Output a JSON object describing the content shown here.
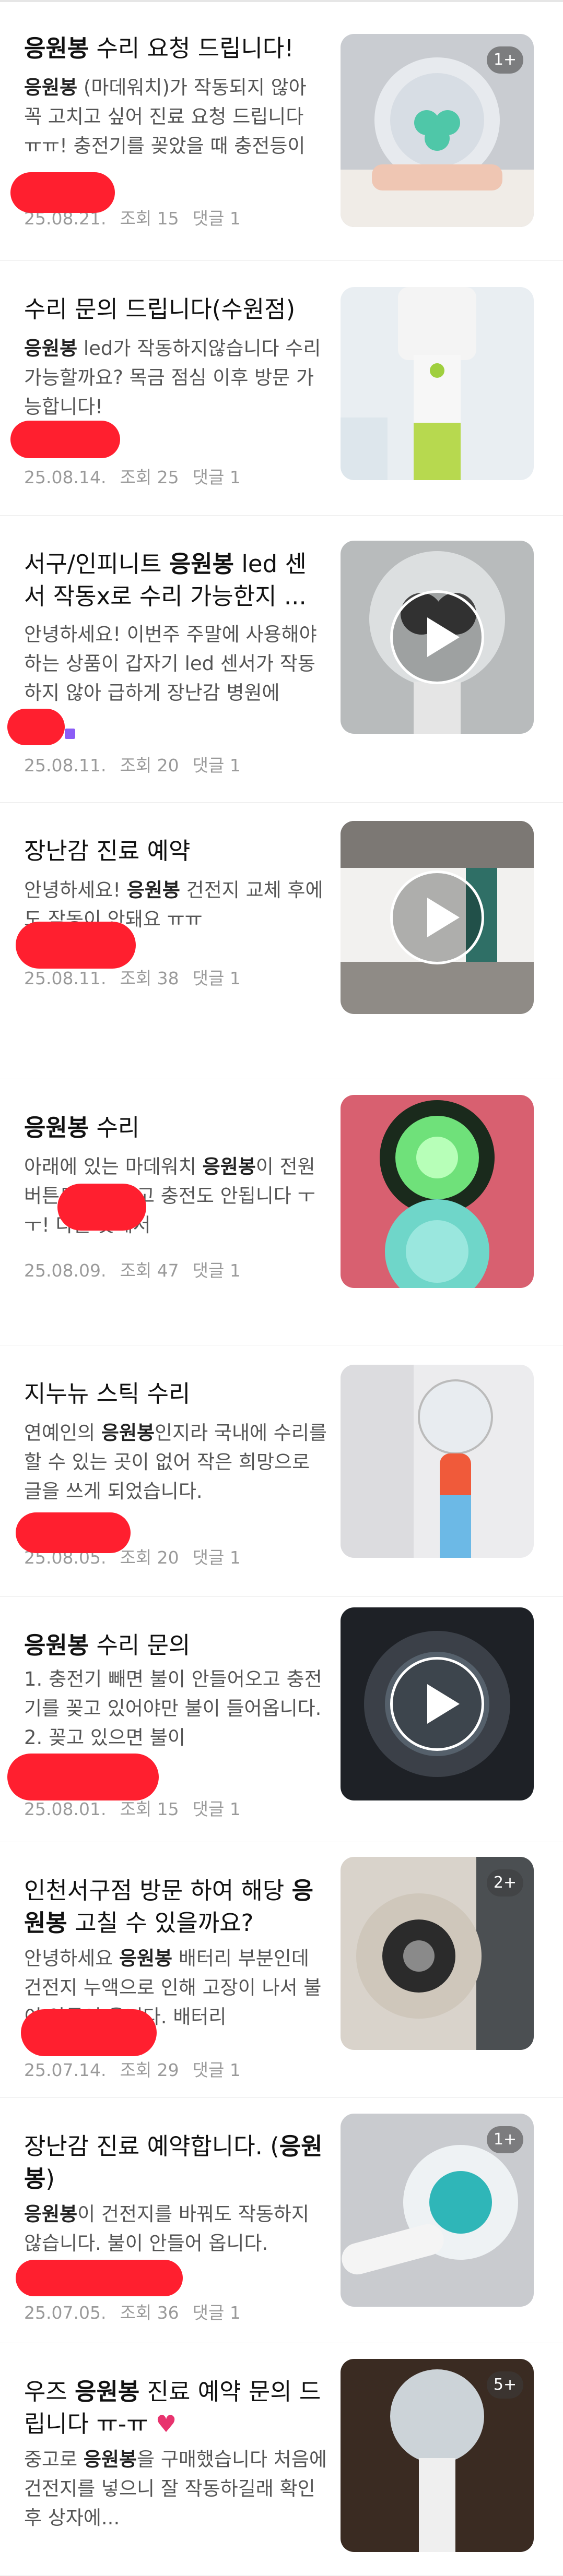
{
  "posts": [
    {
      "title": "<b>응원봉</b> 수리 요청 드립니다!",
      "body": "<b>응원봉</b> (마데워치)가 작동되지 않아 꼭 고치고 싶어 진료 요청 드립니다 ㅠㅠ! 충전기를 꽂았을 때 충전등이",
      "date": "25.08.21.",
      "views": "조회 15",
      "comments": "댓글 1",
      "badge": "1+",
      "play": false
    },
    {
      "title": "수리 문의 드립니다(수원점)",
      "body": "<b>응원봉</b> led가 작동하지않습니다 수리 가능할까요? 목금 점심 이후 방문 가능합니다!",
      "date": "25.08.14.",
      "views": "조회 25",
      "comments": "댓글 1",
      "badge": "",
      "play": false
    },
    {
      "title": "서구/인피니트 <b>응원봉</b> led 센서 작동x로 수리 가능한지 ...",
      "body": "안녕하세요! 이번주 주말에 사용해야 하는 상품이 갑자기 led 센서가 작동하지 않아 급하게 장난감 병원에",
      "date": "25.08.11.",
      "views": "조회 20",
      "comments": "댓글 1",
      "badge": "",
      "play": true
    },
    {
      "title": "장난감 진료 예약",
      "body": "안녕하세요! <b>응원봉</b> 건전지 교체 후에도 작동이 안돼요 ㅠㅠ",
      "date": "25.08.11.",
      "views": "조회 38",
      "comments": "댓글 1",
      "badge": "",
      "play": true
    },
    {
      "title": "<b>응원봉</b> 수리",
      "body": "아래에 있는 마데워치 <b>응원봉</b>이 전원버튼도 안눌리고 충전도 안됩니다 ㅜㅜ! 다른 곳에서",
      "date": "25.08.09.",
      "views": "조회 47",
      "comments": "댓글 1",
      "badge": "",
      "play": false
    },
    {
      "title": "지누뉴 스틱 수리",
      "body": "연예인의 <b>응원봉</b>인지라 국내에 수리를 할 수 있는 곳이 없어 작은 희망으로 글을 쓰게 되었습니다.",
      "date": "25.08.05.",
      "views": "조회 20",
      "comments": "댓글 1",
      "badge": "",
      "play": false
    },
    {
      "title": "<b>응원봉</b> 수리 문의",
      "body": "1. 충전기 빼면 불이 안들어오고 충전기를 꽂고 있어야만 불이 들어옵니다. 2. 꽂고 있으면 불이",
      "date": "25.08.01.",
      "views": "조회 15",
      "comments": "댓글 1",
      "badge": "",
      "play": true
    },
    {
      "title": "인천서구점 방문 하여 해당 <b>응원봉</b> 고칠 수 있을까요?",
      "body": "안녕하세요 <b>응원봉</b> 배터리 부분인데 건전지 누액으로 인해 고장이 나서 불이 안들어 옵니다. 배터리",
      "date": "25.07.14.",
      "views": "조회 29",
      "comments": "댓글 1",
      "badge": "2+",
      "play": false
    },
    {
      "title": "장난감 진료 예약합니다. (<b>응원봉</b>)",
      "body": "<b>응원봉</b>이 건전지를 바꿔도 작동하지 않습니다. 불이 안들어 옵니다.",
      "date": "25.07.05.",
      "views": "조회 36",
      "comments": "댓글 1",
      "badge": "1+",
      "play": false
    },
    {
      "title": "우즈 <b>응원봉</b> 진료 예약 문의 드립니다 ㅠ-ㅠ <span class=\"heart\">♥</span>",
      "body": "중고로 <b>응원봉</b>을 구매했습니다 처음에 건전지를 넣으니 잘 작동하길래 확인 후 상자에...",
      "date": "",
      "views": "",
      "comments": "",
      "badge": "5+",
      "play": false
    }
  ]
}
